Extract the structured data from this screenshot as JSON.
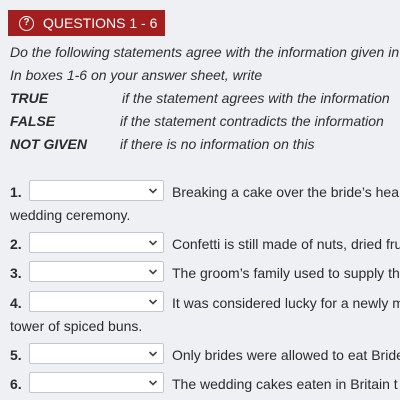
{
  "header": {
    "icon": "question-circle-icon",
    "title": "QUESTIONS 1 - 6",
    "color": "#a31f1f"
  },
  "instructions": {
    "line1": "Do the following statements agree with the information given in",
    "line2": "In boxes 1-6 on your answer sheet, write"
  },
  "answer_key": [
    {
      "label": "TRUE",
      "description": "if the statement agrees with the information"
    },
    {
      "label": "FALSE",
      "description": "if the statement contradicts the information"
    },
    {
      "label": "NOT GIVEN",
      "description": "if there is no information on this"
    }
  ],
  "questions": [
    {
      "number": "1.",
      "selected": "",
      "text": "Breaking a cake over the bride’s hea",
      "continuation": "wedding ceremony."
    },
    {
      "number": "2.",
      "selected": "",
      "text": "Confetti is still made of nuts, dried fru"
    },
    {
      "number": "3.",
      "selected": "",
      "text": "The groom’s family used to supply th"
    },
    {
      "number": "4.",
      "selected": "",
      "text": "It was considered lucky for a newly m",
      "continuation": "tower of spiced buns."
    },
    {
      "number": "5.",
      "selected": "",
      "text": "Only brides were allowed to eat Bride"
    },
    {
      "number": "6.",
      "selected": "",
      "text": "The wedding cakes eaten in Britain t"
    }
  ]
}
